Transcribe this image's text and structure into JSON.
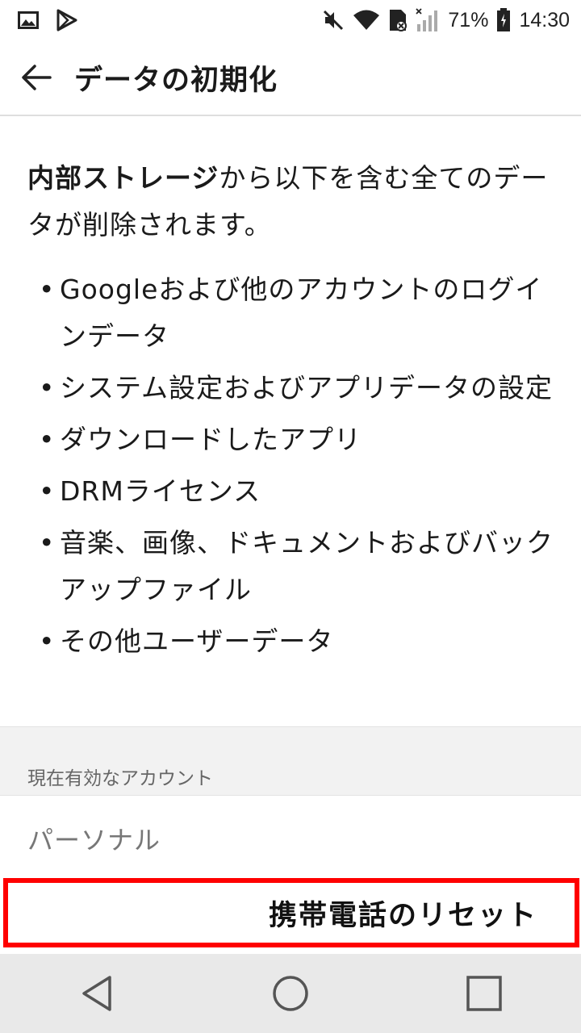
{
  "status_bar": {
    "battery_percent": "71%",
    "time": "14:30",
    "icons": [
      "image-icon",
      "play-store-icon",
      "mute-icon",
      "wifi-icon",
      "sim-icon",
      "signal-icon",
      "battery-icon"
    ]
  },
  "app_bar": {
    "title": "データの初期化"
  },
  "content": {
    "intro_bold": "内部ストレージ",
    "intro_rest": "から以下を含む全てのデータが削除されます。",
    "bullets": [
      "Googleおよび他のアカウントのログインデータ",
      "システム設定およびアプリデータの設定",
      "ダウンロードしたアプリ",
      "DRMライセンス",
      "音楽、画像、ドキュメントおよびバックアップファイル",
      "その他ユーザーデータ"
    ],
    "bullet_mark": "•"
  },
  "accounts": {
    "section_header": "現在有効なアカウント",
    "type_label": "パーソナル"
  },
  "reset": {
    "label": "携帯電話のリセット"
  },
  "colors": {
    "highlight": "#ff0000",
    "nav_bg": "#e9e9e9",
    "section_bg": "#f2f2f2"
  }
}
